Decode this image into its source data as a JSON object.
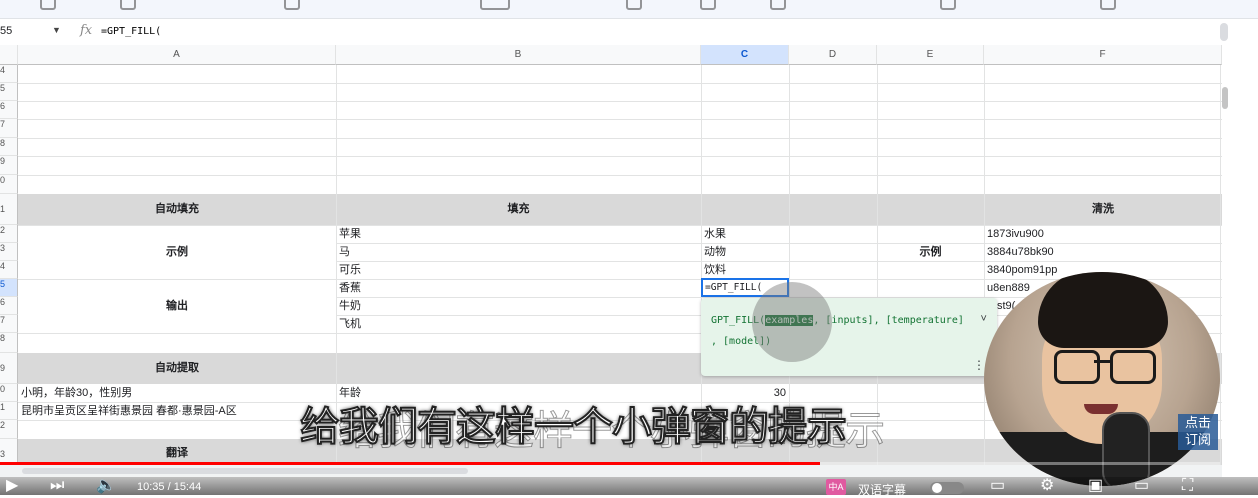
{
  "formula_bar": {
    "name_box": "55",
    "fx": "fx",
    "formula": "=GPT_FILL("
  },
  "columns": [
    "A",
    "B",
    "C",
    "D",
    "E",
    "F"
  ],
  "selected_column": "C",
  "row_numbers": [
    "4",
    "5",
    "6",
    "7",
    "8",
    "9",
    "0",
    "1",
    "2",
    "3",
    "4",
    "5",
    "6",
    "7",
    "8",
    "9",
    "0",
    "1",
    "2",
    "3"
  ],
  "cells": {
    "auto_fill": "自动填充",
    "fill": "填充",
    "clean": "清洗",
    "example_left": "示例",
    "example_right": "示例",
    "output": "输出",
    "auto_extract": "自动提取",
    "translate": "翻译",
    "b_rows": [
      "苹果",
      "马",
      "可乐",
      "香蕉",
      "牛奶",
      "飞机"
    ],
    "c_rows": [
      "水果",
      "动物",
      "饮料"
    ],
    "f_rows": [
      "1873ivu900",
      "3884u78bk90",
      "3840pom91pp",
      "u8en889",
      "st9("
    ],
    "a_extract_1": "小明，年龄30，性别男",
    "a_extract_2": "昆明市呈贡区呈祥街惠景园 春都·惠景园-A区",
    "b_extract_1": "年龄",
    "c_extract_1": "30"
  },
  "active_cell": {
    "value": "=GPT_FILL("
  },
  "tooltip": {
    "fn": "GPT_FILL(",
    "arg_highlight": "examples",
    "rest": ", [inputs], [temperature]",
    "line2": ", [model])"
  },
  "subtitle": "给我们有这样一个小弹窗的提示",
  "subtitle_ghost": "给我们有这样一个小弹窗的提示",
  "subscribe_badge": "点击\n订阅",
  "player": {
    "time": "10:35 / 15:44",
    "progress": 0.672,
    "cc_icon": "中A",
    "cc_label": "双语字幕",
    "icons": [
      "play-icon",
      "next-icon",
      "volume-icon",
      "settings-icon",
      "miniplayer-icon",
      "theater-icon",
      "fullscreen-icon"
    ]
  },
  "colors": {
    "header_band": "#d9d9d9",
    "selection": "#1a73e8",
    "tooltip_bg": "#e6f4ea",
    "progress": "#ff0000"
  }
}
